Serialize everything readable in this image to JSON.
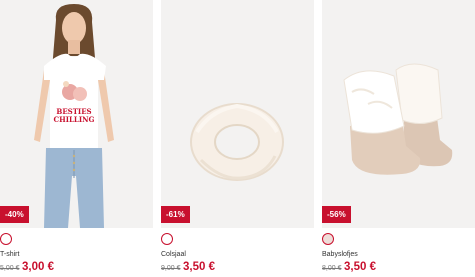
{
  "products": [
    {
      "name": "T-shirt",
      "discount": "-40%",
      "old_price": "5,00 €",
      "new_price": "3,00 €",
      "shirt_text_1": "BESTIES",
      "shirt_text_2": "CHILLING"
    },
    {
      "name": "Colsjaal",
      "discount": "-61%",
      "old_price": "9,00 €",
      "new_price": "3,50 €"
    },
    {
      "name": "Babyslofjes",
      "discount": "-56%",
      "old_price": "8,00 €",
      "new_price": "3,50 €"
    }
  ],
  "colors": {
    "sale": "#c8102e",
    "image_bg": "#f3f2f1"
  }
}
